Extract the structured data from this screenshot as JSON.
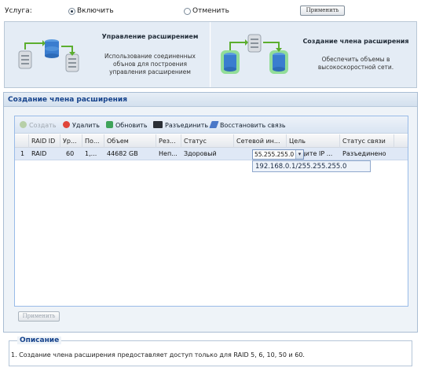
{
  "service": {
    "label": "Услуга:",
    "option_enable": "Включить",
    "option_disable": "Отменить",
    "selected": "enable",
    "apply_label": "Применить"
  },
  "cards": {
    "manage": {
      "title": "Управление расширением",
      "desc_lines": [
        "Использование соединенных",
        "обънов для построения",
        "управления расширением"
      ]
    },
    "create": {
      "title": "Создание члена расширения",
      "desc_lines": [
        "Обеспечить объемы в",
        "высокоскоростной сети."
      ]
    }
  },
  "section": {
    "title": "Создание члена расширения"
  },
  "toolbar": {
    "create": "Создать",
    "delete": "Удалить",
    "refresh": "Обновить",
    "disconnect": "Разъединить",
    "reconnect": "Восстановить связь"
  },
  "grid": {
    "columns": [
      "RAID ID",
      "Ур...",
      "По...",
      "Объем",
      "Рез...",
      "Статус",
      "Сетевой ин...",
      "Цель",
      "Статус связи"
    ],
    "rows": [
      {
        "num": "1",
        "raid_id": "RAID",
        "level": "60",
        "pos": "1,...",
        "volume": "44682 GB",
        "reserve": "Неп...",
        "status": "Здоровый",
        "network": "55.255.255.0",
        "target": "Введите IP ...",
        "link_status": "Разъединено"
      }
    ],
    "dropdown_option": "192.168.0.1/255.255.255.0"
  },
  "apply_bottom_label": "Применить",
  "description": {
    "legend": "Описание",
    "text": "1. Создание члена расширения предоставляет доступ только для RAID 5, 6, 10, 50 и 60."
  },
  "colors": {
    "section_title": "#15428b",
    "selected_row": "#dfe8f6",
    "card_bg": "#e4ecf5"
  }
}
